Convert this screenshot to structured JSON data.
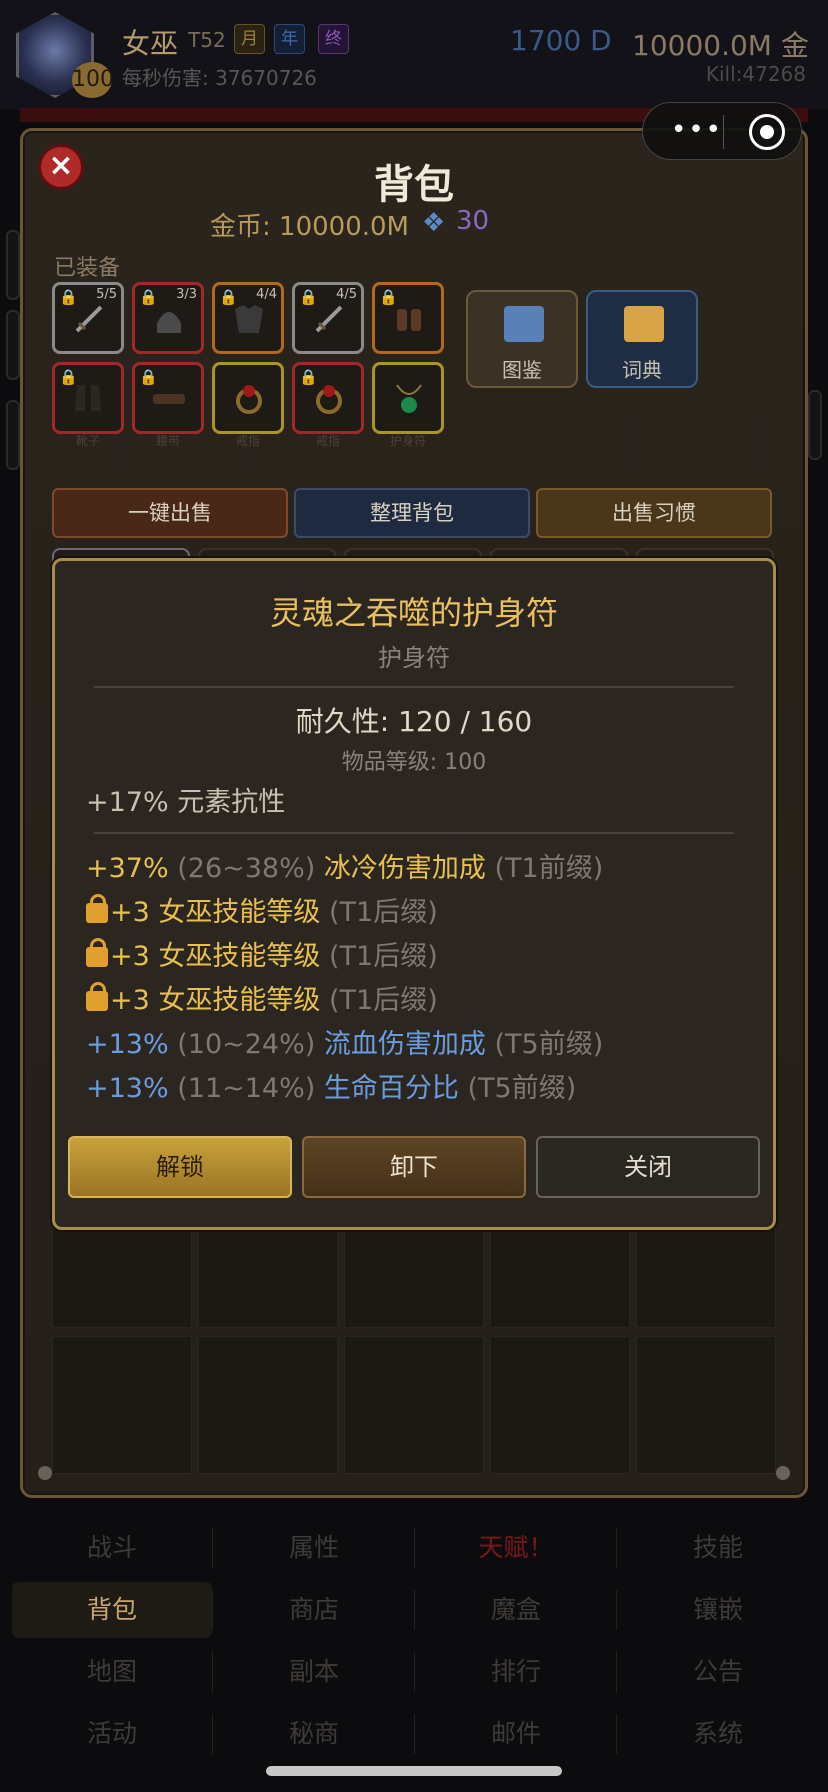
{
  "header": {
    "character_name": "女巫",
    "tier": "T52",
    "badges": [
      "月",
      "年",
      "终"
    ],
    "level": "100",
    "dps_label": "每秒伤害: 37670726",
    "diamonds": "1700 D",
    "gold": "10000.0M 金",
    "kills": "Kill:47268"
  },
  "capsule": {
    "more": "•••"
  },
  "bag": {
    "title": "背包",
    "gold_line": "金币: 10000.0M",
    "gem_count": "30",
    "equipped_label": "已装备",
    "equipped": [
      {
        "name": "sword",
        "count": "5/5",
        "rarity": "gray"
      },
      {
        "name": "helmet",
        "count": "3/3",
        "rarity": "red"
      },
      {
        "name": "armor",
        "count": "4/4",
        "rarity": "orange"
      },
      {
        "name": "sword",
        "count": "4/5",
        "rarity": "gray"
      },
      {
        "name": "gloves",
        "count": "",
        "rarity": "orange"
      },
      {
        "name": "boots",
        "caption": "靴子",
        "rarity": "red"
      },
      {
        "name": "belt",
        "caption": "腰带",
        "rarity": "red"
      },
      {
        "name": "ring",
        "caption": "戒指",
        "rarity": "yellow"
      },
      {
        "name": "ring",
        "caption": "戒指",
        "rarity": "red"
      },
      {
        "name": "amulet",
        "caption": "护身符",
        "rarity": "yellow"
      }
    ],
    "atlas_label": "图鉴",
    "dictionary_label": "词典",
    "actions": {
      "sell": "一键出售",
      "sort": "整理背包",
      "habit": "出售习惯"
    }
  },
  "tooltip": {
    "item_name": "灵魂之吞噬的护身符",
    "item_type": "护身符",
    "durability": "耐久性: 120 / 160",
    "item_level": "物品等级: 100",
    "implicit": "+17% 元素抗性",
    "affixes": [
      {
        "value": "+37%",
        "range": "(26~38%)",
        "stat": "冰冷伤害加成",
        "tier": "(T1前缀)",
        "locked": false,
        "color": "#e8c050"
      },
      {
        "value": "+3",
        "range": "",
        "stat": "女巫技能等级",
        "tier": "(T1后缀)",
        "locked": true,
        "color": "#e8c050"
      },
      {
        "value": "+3",
        "range": "",
        "stat": "女巫技能等级",
        "tier": "(T1后缀)",
        "locked": true,
        "color": "#e8c050"
      },
      {
        "value": "+3",
        "range": "",
        "stat": "女巫技能等级",
        "tier": "(T1后缀)",
        "locked": true,
        "color": "#e8c050"
      },
      {
        "value": "+13%",
        "range": "(10~24%)",
        "stat": "流血伤害加成",
        "tier": "(T5前缀)",
        "locked": false,
        "color": "#6a9ce0"
      },
      {
        "value": "+13%",
        "range": "(11~14%)",
        "stat": "生命百分比",
        "tier": "(T5前缀)",
        "locked": false,
        "color": "#6a9ce0"
      }
    ],
    "buttons": {
      "unlock": "解锁",
      "unequip": "卸下",
      "close": "关闭"
    }
  },
  "nav": {
    "row1": [
      "战斗",
      "属性",
      "天赋！",
      "技能"
    ],
    "row2": [
      "背包",
      "商店",
      "魔盒",
      "镶嵌"
    ],
    "row3": [
      "地图",
      "副本",
      "排行",
      "公告"
    ],
    "row4": [
      "活动",
      "秘商",
      "邮件",
      "系统"
    ]
  }
}
